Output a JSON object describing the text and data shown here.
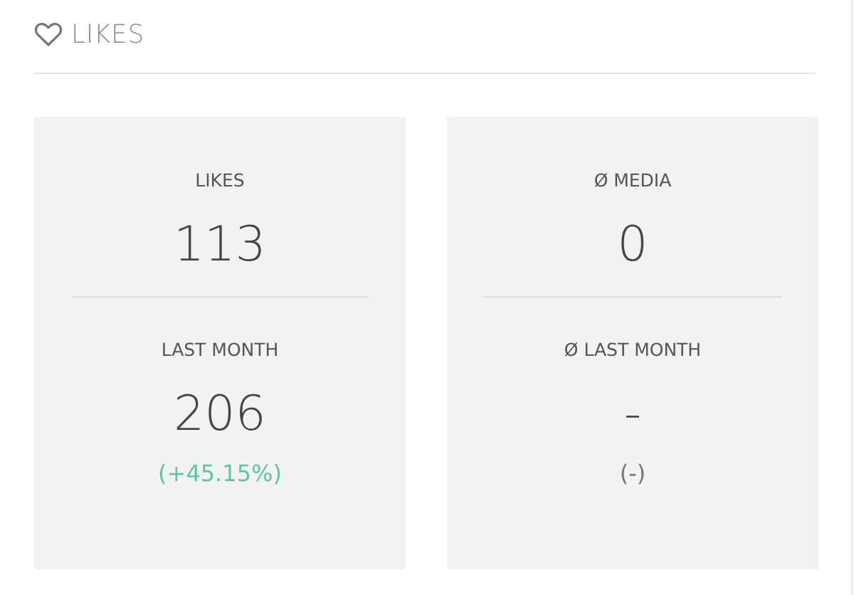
{
  "header": {
    "title": "LIKES"
  },
  "cards": [
    {
      "top": {
        "label": "LIKES",
        "value": "113"
      },
      "bottom": {
        "label": "LAST MONTH",
        "value": "206",
        "change": "(+45.15%)",
        "positive": true
      }
    },
    {
      "top": {
        "label": "Ø MEDIA",
        "value": "0"
      },
      "bottom": {
        "label": "Ø LAST MONTH",
        "value": "-",
        "change": "(-)",
        "positive": false
      }
    }
  ]
}
